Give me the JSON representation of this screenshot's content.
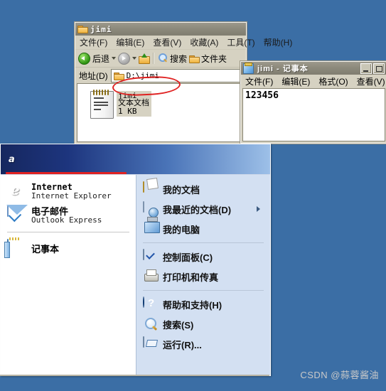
{
  "desktop": {
    "background_color": "#3b6ea5"
  },
  "explorer_window": {
    "title": "jimi",
    "title_icon": "folder-icon",
    "menu": [
      {
        "label": "文件(F)"
      },
      {
        "label": "编辑(E)"
      },
      {
        "label": "查看(V)"
      },
      {
        "label": "收藏(A)"
      },
      {
        "label": "工具(T)"
      },
      {
        "label": "帮助(H)"
      }
    ],
    "toolbar": {
      "back_label": "后退",
      "forward_label": "",
      "up_label": "",
      "search_label": "搜索",
      "folders_label": "文件夹"
    },
    "address": {
      "label": "地址(D)",
      "value": "D:\\jimi",
      "icon": "folder-icon"
    },
    "files": [
      {
        "name": "jimi",
        "type": "文本文档",
        "size": "1 KB",
        "icon": "notepad-file-icon",
        "selected": true
      }
    ],
    "annotation": {
      "shape": "red-ellipse",
      "color": "#e02222",
      "target": "address-bar"
    }
  },
  "notepad_window": {
    "title": "jimi - 记事本",
    "title_icon": "notepad-icon",
    "menu": [
      {
        "label": "文件(F)"
      },
      {
        "label": "编辑(E)"
      },
      {
        "label": "格式(O)"
      },
      {
        "label": "查看(V)"
      }
    ],
    "content": "123456"
  },
  "start_menu": {
    "username": "a",
    "username_underline_color": "#e02222",
    "left_column": {
      "pinned": [
        {
          "title": "Internet",
          "subtitle": "Internet Explorer",
          "icon": "internet-explorer-icon"
        },
        {
          "title": "电子邮件",
          "subtitle": "Outlook Express",
          "icon": "mail-icon"
        }
      ],
      "programs": [
        {
          "label": "记事本",
          "icon": "notepad-icon"
        }
      ]
    },
    "right_column": {
      "group1": [
        {
          "label": "我的文档",
          "icon": "my-documents-icon",
          "has_submenu": false
        },
        {
          "label": "我最近的文档(D)",
          "icon": "recent-documents-icon",
          "has_submenu": true
        },
        {
          "label": "我的电脑",
          "icon": "my-computer-icon",
          "has_submenu": false
        }
      ],
      "group2": [
        {
          "label": "控制面板(C)",
          "icon": "control-panel-icon",
          "has_submenu": false
        },
        {
          "label": "打印机和传真",
          "icon": "printer-icon",
          "has_submenu": false
        }
      ],
      "group3": [
        {
          "label": "帮助和支持(H)",
          "icon": "help-icon",
          "has_submenu": false
        },
        {
          "label": "搜索(S)",
          "icon": "search-icon",
          "has_submenu": false
        },
        {
          "label": "运行(R)...",
          "icon": "run-icon",
          "has_submenu": false
        }
      ]
    }
  },
  "watermark": {
    "text": "CSDN @蒜蓉酱油"
  }
}
